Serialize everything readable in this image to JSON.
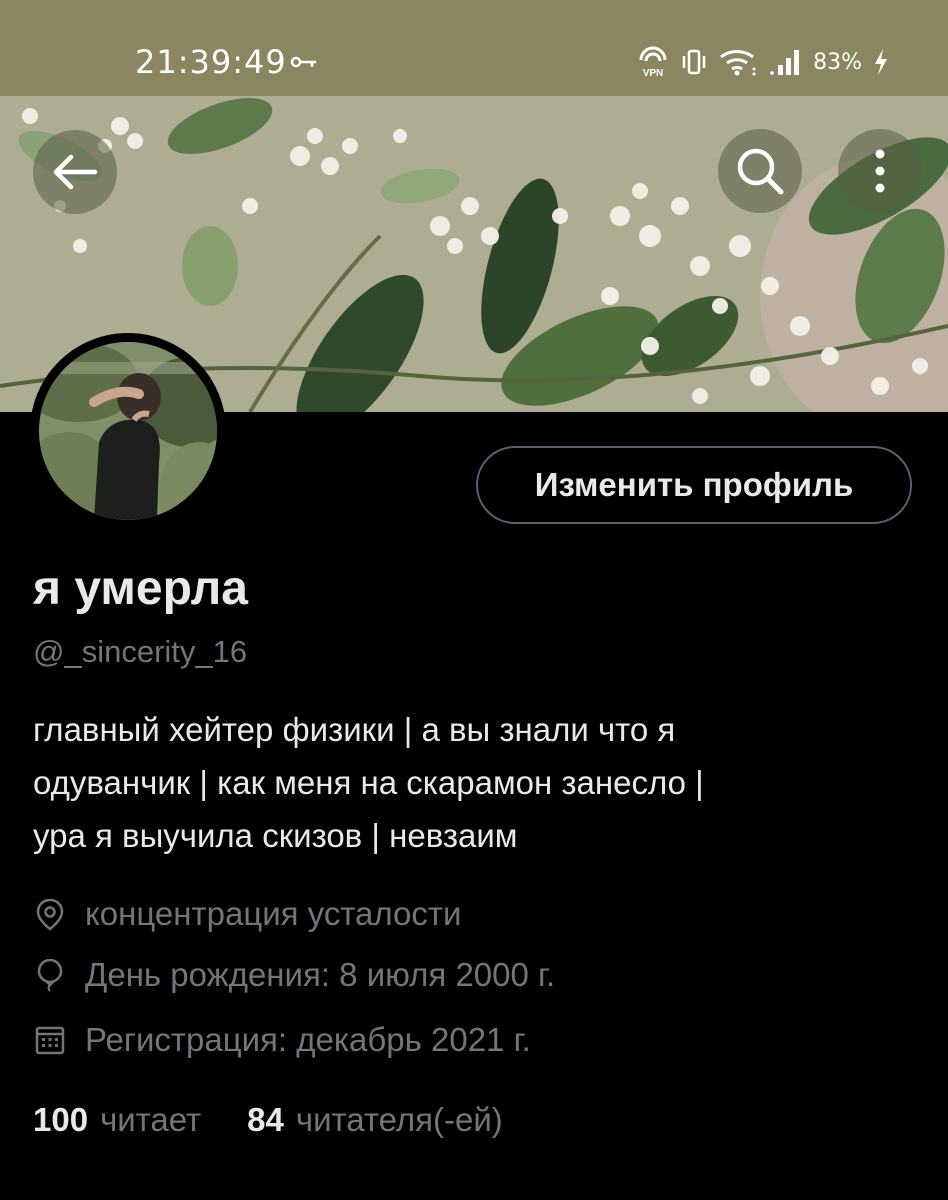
{
  "status_bar": {
    "time": "21:39:49",
    "vpn_label": "VPN",
    "battery": "83%"
  },
  "profile": {
    "name": "я умерла",
    "handle": "@_sincerity_16",
    "edit_button_label": "Изменить профиль",
    "bio_lines": [
      "главный хейтер физики | а вы знали что я",
      "одуванчик | как меня на скарамон занесло |",
      "ура я выучила скизов | невзаим"
    ],
    "location": "концентрация усталости",
    "birthday": "День рождения: 8 июля 2000 г.",
    "joined": "Регистрация: декабрь 2021 г.",
    "following_count": "100",
    "following_label": "читает",
    "followers_count": "84",
    "followers_label": "читателя(-ей)"
  },
  "icons": {
    "back": "arrow-left-icon",
    "search": "search-icon",
    "more": "more-vertical-icon",
    "location": "location-pin-icon",
    "birthday": "balloon-icon",
    "calendar": "calendar-icon"
  },
  "colors": {
    "status_bar_bg": "#8a8760",
    "text_primary": "#e7e9ea",
    "text_secondary": "#71767b",
    "button_border": "#536471"
  }
}
